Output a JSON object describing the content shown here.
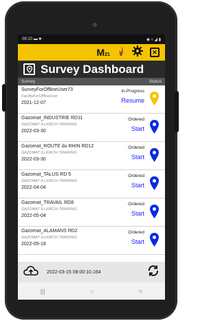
{
  "statusbar": {
    "time": "08:10",
    "left_icons": "▬ ■ ·",
    "right_icons": "◉ ▿ ◢ ▮"
  },
  "appbar": {
    "logo": "M",
    "logo_sub": "21"
  },
  "title": {
    "text": "Survey Dashboard"
  },
  "columns": {
    "left": "Survey",
    "right": "Status"
  },
  "rows": [
    {
      "name": "SurveyForOfflineUser73",
      "sub": "FacilityForOfflineUser",
      "date": "2021-12-07",
      "status": "In-Progress",
      "action": "Resume",
      "pin_color": "#f5c400"
    },
    {
      "name": "Gazomat_INDUSTRIE RD11",
      "sub": "GAZOMAT  ILLKIRCH TRAINING",
      "date": "2022-03-30",
      "status": "Ordered",
      "action": "Start",
      "pin_color": "#0a2be0"
    },
    {
      "name": "Gazomat_ROUTE du RHIN RD12",
      "sub": "GAZOMAT  ILLKIRCH TRAINING",
      "date": "2022-03-30",
      "status": "Ordered",
      "action": "Start",
      "pin_color": "#0a2be0"
    },
    {
      "name": "Gazomat_TALUS RD 5",
      "sub": "GAZOMAT  ILLKIRCH TRAINING",
      "date": "2022-04-04",
      "status": "Ordered",
      "action": "Start",
      "pin_color": "#0a2be0"
    },
    {
      "name": "Gazomat_TRAVAIL RD8",
      "sub": "GAZOMAT  ILLKIRCH TRAINING",
      "date": "2022-05-04",
      "status": "Ordered",
      "action": "Start",
      "pin_color": "#0a2be0"
    },
    {
      "name": "Gazomat_ALAMANS RD2",
      "sub": "GAZOMAT  ILLKIRCH TRAINING",
      "date": "2022-05-18",
      "status": "Ordered",
      "action": "Start",
      "pin_color": "#0a2be0"
    }
  ],
  "footer": {
    "sync_time": "2022-03-15 08:00:10.164"
  },
  "navbar": {
    "recents": "|||",
    "home": "○",
    "back": "<"
  },
  "colors": {
    "accent": "#f5c400",
    "title_bg": "#2a2a2a",
    "link": "#1a1aff"
  }
}
